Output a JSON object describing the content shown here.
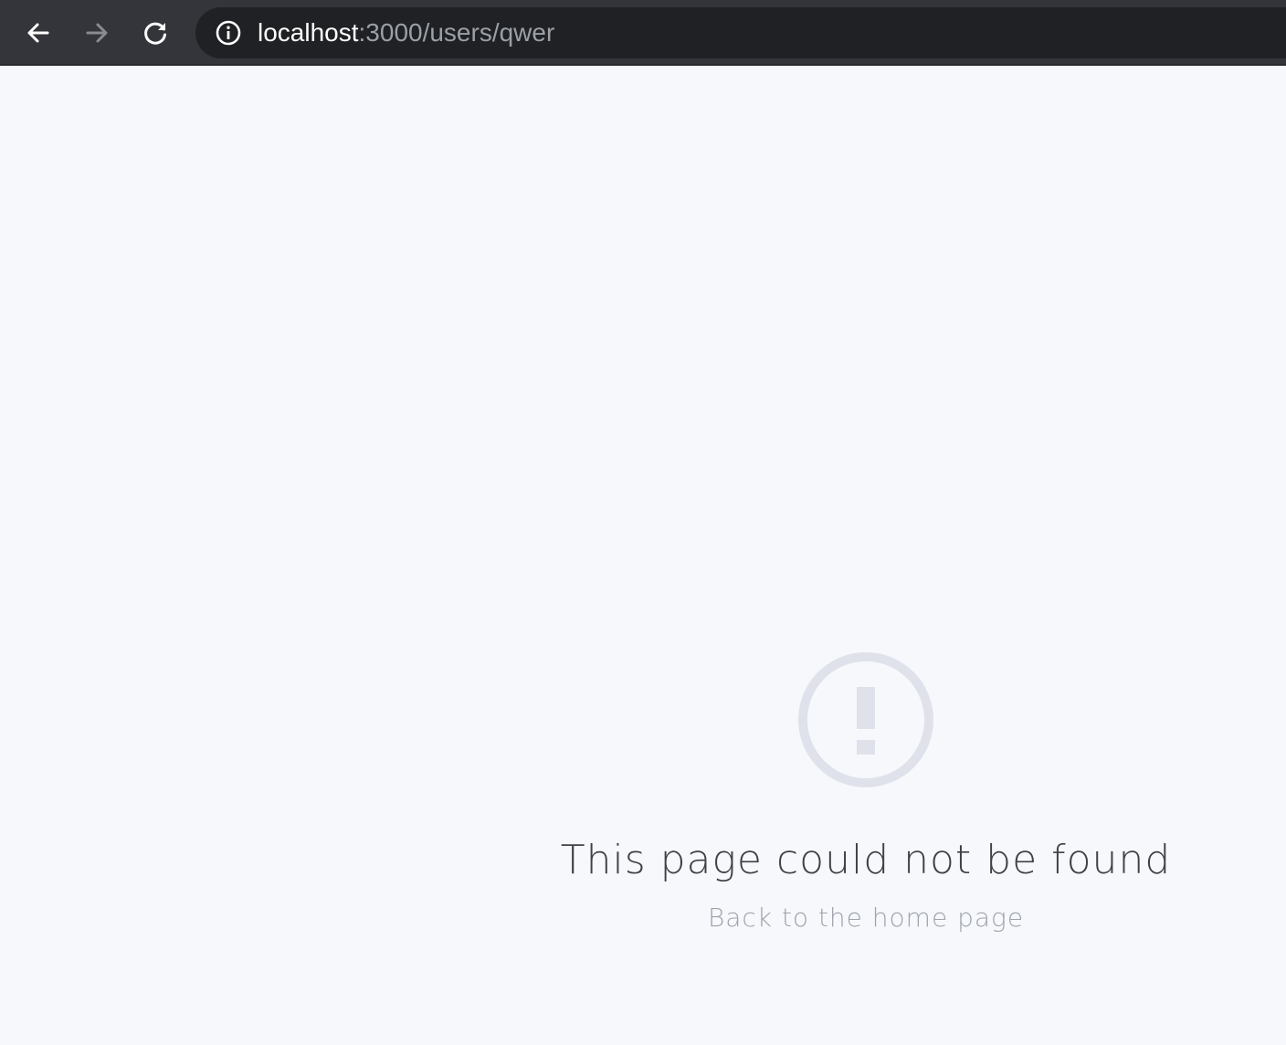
{
  "browser": {
    "url_host": "localhost",
    "url_path": ":3000/users/qwer",
    "icons": {
      "back": "arrow-left-icon",
      "forward": "arrow-right-icon",
      "reload": "reload-icon",
      "info": "info-icon"
    }
  },
  "page": {
    "icon": "exclamation-circle-icon",
    "title": "This page could not be found",
    "home_link": "Back to the home page"
  },
  "colors": {
    "toolbar_bg": "#34353a",
    "omnibox_bg": "#202124",
    "page_bg": "#f7f8fc",
    "icon_color": "#dfe2ea",
    "title_color": "#3f4146",
    "link_color": "#9ea3ad"
  }
}
